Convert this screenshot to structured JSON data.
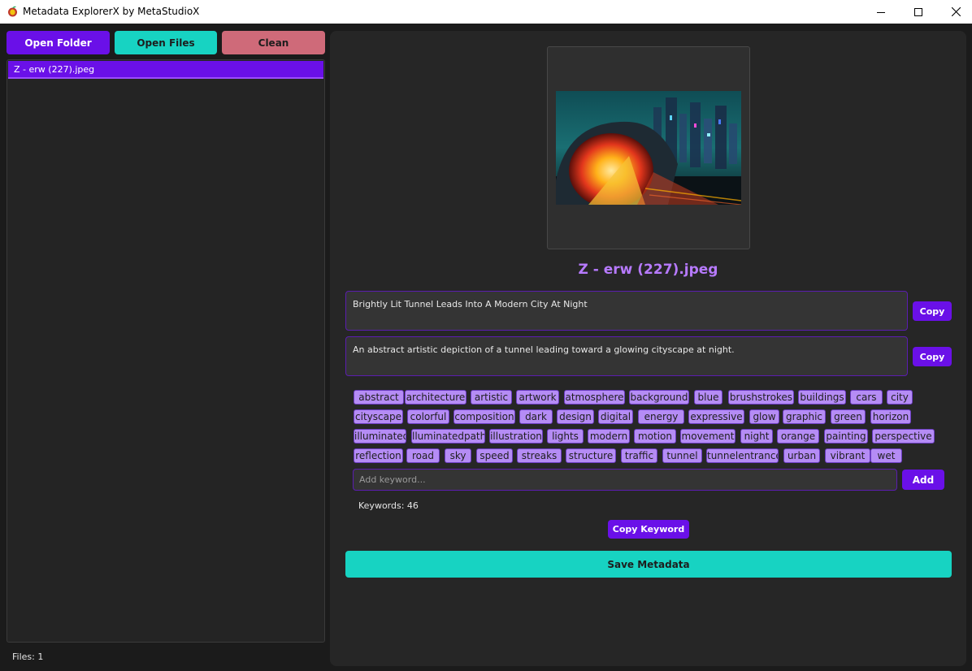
{
  "window": {
    "title": "Metadata ExplorerX by MetaStudioX",
    "icon": "app-logo-icon"
  },
  "toolbar": {
    "open_folder": "Open Folder",
    "open_files": "Open Files",
    "clean": "Clean"
  },
  "colors": {
    "accent_purple": "#6a10e8",
    "accent_teal": "#17d3c2",
    "clean_red": "#cf6a79",
    "title_purple": "#b77aff",
    "tag_purple": "#b58cf5"
  },
  "file_list": {
    "items": [
      "Z - erw (227).jpeg"
    ],
    "selected_index": 0
  },
  "status": {
    "files_count": "Files: 1"
  },
  "preview": {
    "file_name": "Z - erw (227).jpeg"
  },
  "metadata": {
    "title": "Brightly Lit Tunnel Leads Into A Modern City At Night",
    "description": "An abstract artistic depiction of a tunnel leading toward a glowing cityscape at night.",
    "copy_label": "Copy"
  },
  "keywords": {
    "tags": [
      "abstract",
      "architecture",
      "artistic",
      "artwork",
      "atmosphere",
      "background",
      "blue",
      "brushstrokes",
      "buildings",
      "cars",
      "city",
      "cityscape",
      "colorful",
      "composition",
      "dark",
      "design",
      "digital",
      "energy",
      "expressive",
      "glow",
      "graphic",
      "green",
      "horizon",
      "illuminated",
      "lluminatedpath",
      "illustration",
      "lights",
      "modern",
      "motion",
      "movement",
      "night",
      "orange",
      "painting",
      "perspective",
      "reflection",
      "road",
      "sky",
      "speed",
      "streaks",
      "structure",
      "traffic",
      "tunnel",
      "tunnelentrance",
      "urban",
      "vibrant",
      "wet"
    ],
    "input_placeholder": "Add keyword...",
    "add_label": "Add",
    "count_label": "Keywords: 46",
    "copy_keyword_label": "Copy Keyword"
  },
  "actions": {
    "save_metadata": "Save Metadata"
  }
}
